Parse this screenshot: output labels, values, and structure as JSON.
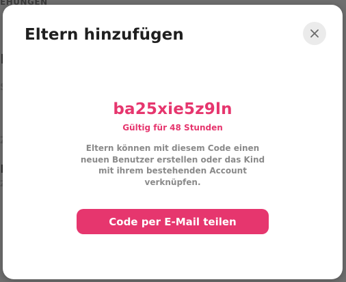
{
  "background": {
    "top_text": "EHUNGEN",
    "frag_1": "r",
    "frag_2": "S",
    "frag_3": "Z",
    "frag_4": "n",
    "frag_5": "Z"
  },
  "modal": {
    "title": "Eltern hinzufügen",
    "close_icon": "close-icon",
    "code": "ba25xie5z9ln",
    "validity": "Gültig für 48 Stunden",
    "description": "Eltern können mit diesem Code einen neuen Benutzer erstellen oder das Kind mit ihrem bestehenden Account verknüpfen.",
    "share_button_label": "Code per E-Mail teilen"
  },
  "colors": {
    "accent": "#e6366e",
    "title": "#1f1f1f",
    "muted_text": "#8a8a8a",
    "close_bg": "#ebebeb",
    "overlay": "#6f6f6f"
  }
}
